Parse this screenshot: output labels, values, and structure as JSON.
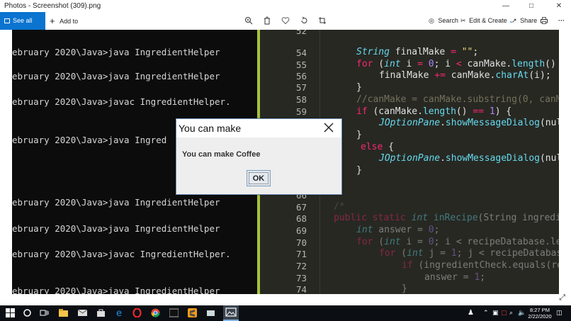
{
  "window": {
    "title": "Photos - Screenshot (309).png",
    "controls": [
      "minimize",
      "maximize",
      "close"
    ]
  },
  "toolbar": {
    "see_all_label": "See all photos",
    "add_to_label": "Add to",
    "search_label": "Search",
    "edit_create_label": "Edit & Create",
    "share_label": "Share",
    "more_label": "···",
    "accent_color": "#0a74d0"
  },
  "terminal": {
    "lines": [
      "ebruary 2020\\Java>java IngredientHelper",
      "ebruary 2020\\Java>java IngredientHelper",
      "ebruary 2020\\Java>javac IngredientHelper.",
      "ebruary 2020\\Java>java Ingred",
      "ebruary 2020\\Java>java IngredientHelper",
      "ebruary 2020\\Java>java IngredientHelper",
      "ebruary 2020\\Java>javac IngredientHelper.",
      "ebruary 2020\\Java>java IngredientHelper"
    ]
  },
  "editor": {
    "line_numbers": [
      "52",
      "54",
      "55",
      "56",
      "57",
      "58",
      "59",
      "",
      "",
      "",
      "",
      "66",
      "67",
      "68",
      "69",
      "70",
      "71",
      "72",
      "73",
      "74"
    ],
    "gutter_color": "#a6c33a",
    "background": "#272822"
  },
  "dialog": {
    "title": "You can make",
    "message": "You can make Coffee",
    "ok_label": "OK"
  },
  "taskbar": {
    "time": "8:27 PM",
    "date": "2/22/2020"
  }
}
